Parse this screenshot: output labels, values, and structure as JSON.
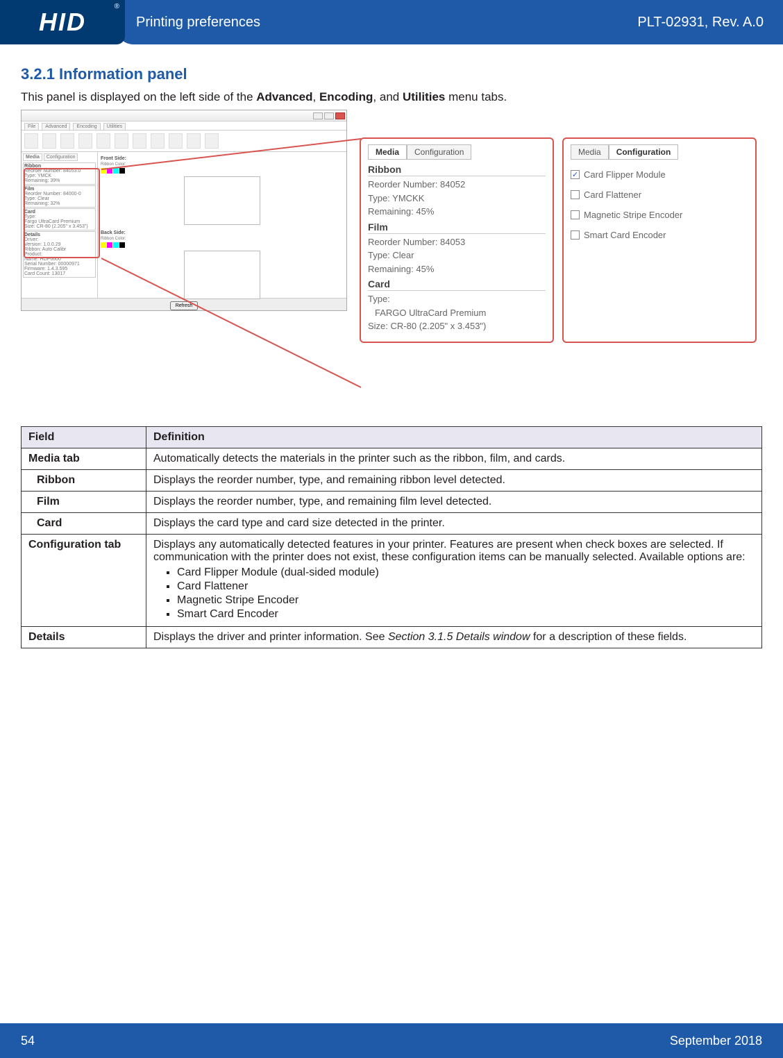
{
  "header": {
    "logo_text": "HID",
    "reg": "®",
    "title": "Printing preferences",
    "doc_ref": "PLT-02931, Rev. A.0"
  },
  "section": {
    "heading": "3.2.1 Information panel",
    "intro_pre": "This panel is displayed on the left side of the ",
    "intro_b1": "Advanced",
    "intro_sep1": ", ",
    "intro_b2": "Encoding",
    "intro_sep2": ", and ",
    "intro_b3": "Utilities",
    "intro_post": " menu tabs."
  },
  "dialog": {
    "tabs": [
      "File",
      "Advanced",
      "Encoding",
      "Utilities"
    ],
    "mini_tabs": [
      "Media",
      "Configuration"
    ],
    "ribbon": {
      "hdr": "Ribbon",
      "l1": "Reorder Number: 84053.0",
      "l2": "Type: YMCK",
      "l3": "Remaining: 39%"
    },
    "film": {
      "hdr": "Film",
      "l1": "Reorder Number: 84000-0",
      "l2": "Type: Clear",
      "l3": "Remaining: 32%"
    },
    "card": {
      "hdr": "Card",
      "l1": "Type:",
      "l2": "Fargo UltraCard Premium",
      "l3": "Size: CR-80 (2.205\" x 3.453\")"
    },
    "details": {
      "hdr": "Details",
      "l1": "Driver:",
      "l2": "Version: 1.0.0.29",
      "l3": "Ribbon: Auto Calibr",
      "l4": "Product:",
      "l5": "Name: HDP6600",
      "l6": "Serial Number: 00000971",
      "l7": "Firmware: 1.4.3.595",
      "l8": "Card Count: 13017"
    },
    "front": "Front Side:",
    "back": "Back Side:",
    "ribbon_color": "Ribbon Color:",
    "refresh": "Refresh"
  },
  "zoom_media": {
    "tab_media": "Media",
    "tab_config": "Configuration",
    "ribbon": {
      "hdr": "Ribbon",
      "l1": "Reorder Number: 84052",
      "l2": "Type: YMCKK",
      "l3": "Remaining: 45%"
    },
    "film": {
      "hdr": "Film",
      "l1": "Reorder Number: 84053",
      "l2": "Type: Clear",
      "l3": "Remaining: 45%"
    },
    "card": {
      "hdr": "Card",
      "l1": "Type:",
      "l2": "FARGO UltraCard Premium",
      "l3": "Size: CR-80 (2.205\" x 3.453\")"
    }
  },
  "zoom_config": {
    "tab_media": "Media",
    "tab_config": "Configuration",
    "items": [
      {
        "label": "Card Flipper Module",
        "checked": true
      },
      {
        "label": "Card Flattener",
        "checked": false
      },
      {
        "label": "Magnetic Stripe Encoder",
        "checked": false
      },
      {
        "label": "Smart Card Encoder",
        "checked": false
      }
    ]
  },
  "table": {
    "h_field": "Field",
    "h_def": "Definition",
    "rows": {
      "media_tab": {
        "field": "Media tab",
        "def": "Automatically detects the materials in the printer such as the ribbon, film, and cards."
      },
      "ribbon": {
        "field": "Ribbon",
        "def": "Displays the reorder number, type, and remaining ribbon level detected."
      },
      "film": {
        "field": "Film",
        "def": "Displays the reorder number, type, and remaining film level detected."
      },
      "card": {
        "field": "Card",
        "def": "Displays the card type and card size detected in the printer."
      },
      "config": {
        "field": "Configuration tab",
        "def": "Displays any automatically detected features in your printer. Features are present when check boxes are selected. If communication with the printer does not exist, these configuration items can be manually selected. Available options are:",
        "bullets": [
          "Card Flipper Module (dual-sided module)",
          "Card Flattener",
          "Magnetic Stripe Encoder",
          "Smart Card Encoder"
        ]
      },
      "details": {
        "field": "Details",
        "def_pre": "Displays the driver and printer information. See ",
        "def_italic": "Section 3.1.5 Details window",
        "def_post": " for a description of these fields."
      }
    }
  },
  "footer": {
    "page": "54",
    "date": "September 2018"
  }
}
